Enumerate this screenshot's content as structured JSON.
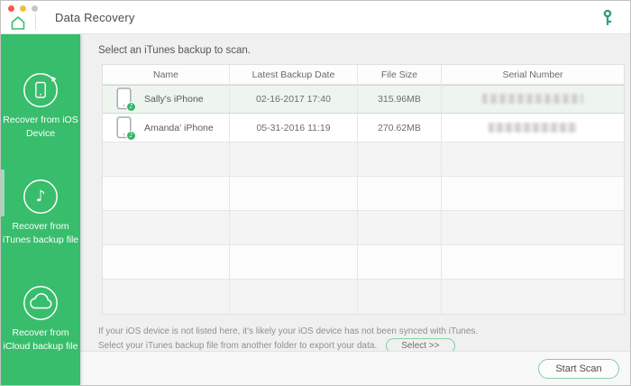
{
  "titlebar": {
    "title": "Data Recovery",
    "window_buttons": [
      "close",
      "minimize",
      "zoom"
    ],
    "left_icon": "home-icon",
    "right_icon": "key-icon"
  },
  "sidebar": {
    "selected_index": 1,
    "items": [
      {
        "label": "Recover from iOS Device",
        "icon": "ios-device-icon",
        "selected": false
      },
      {
        "label": "Recover from iTunes backup file",
        "icon": "itunes-note-icon",
        "selected": true
      },
      {
        "label": "Recover from iCloud backup file",
        "icon": "icloud-cloud-icon",
        "selected": false
      }
    ]
  },
  "main": {
    "heading": "Select an iTunes backup to scan."
  },
  "table": {
    "columns": [
      "Name",
      "Latest Backup Date",
      "File Size",
      "Serial Number"
    ],
    "rows": [
      {
        "name": "Sally's iPhone",
        "date": "02-16-2017 17:40",
        "size": "315.96MB",
        "serial_blurred": true,
        "selected": true,
        "icon": "iphone-icon-with-music-badge"
      },
      {
        "name": "Amanda' iPhone",
        "date": "05-31-2016 11:19",
        "size": "270.62MB",
        "serial_blurred": true,
        "selected": false,
        "icon": "iphone-icon-with-music-badge"
      }
    ],
    "empty_row_count": 5
  },
  "note": {
    "line1": "If your iOS device is not listed here, it's likely your iOS device has not been synced with iTunes.",
    "line2": "Select your iTunes backup file from another folder to export your data.",
    "select_button": "Select >>"
  },
  "footer": {
    "start_scan": "Start Scan"
  },
  "colors": {
    "sidebar_green": "#38bd6c",
    "sidebar_indicator": "#9edcba",
    "key_icon_teal": "#2f9b8a",
    "selected_row_bg": "#eef5ee",
    "selected_row_border": "#c5e2c5",
    "button_border_green": "#85cda4",
    "traffic_red": "#f6574e",
    "traffic_yellow": "#f6be40",
    "traffic_gray": "#c9c7c5"
  }
}
